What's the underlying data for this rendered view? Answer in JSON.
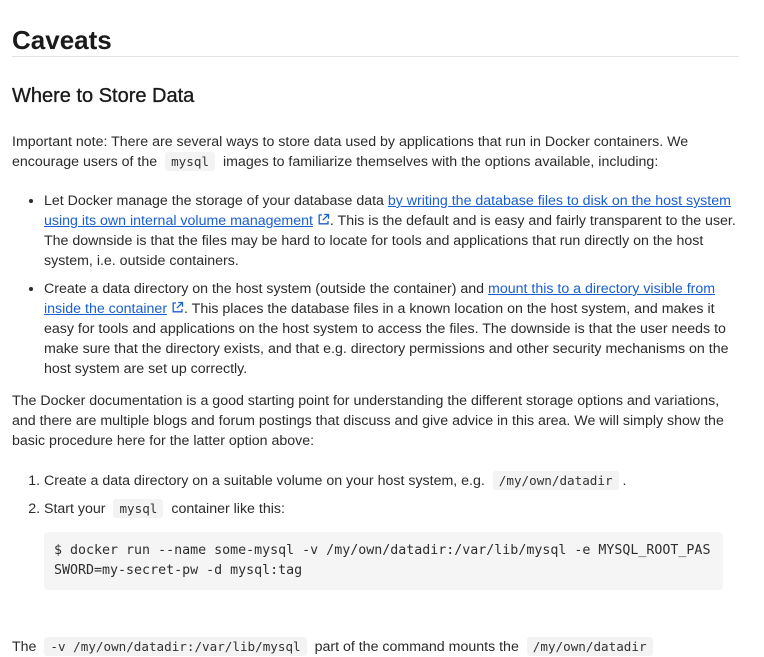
{
  "heading": "Caveats",
  "subheading": "Where to Store Data",
  "intro": {
    "before_code": "Important note: There are several ways to store data used by applications that run in Docker containers. We encourage users of the",
    "code": "mysql",
    "after_code": "images to familiarize themselves with the options available, including:"
  },
  "bullets": [
    {
      "before_link": "Let Docker manage the storage of your database data ",
      "link": "by writing the database files to disk on the host system using its own internal volume management",
      "after_link": ". This is the default and is easy and fairly transparent to the user. The downside is that the files may be hard to locate for tools and applications that run directly on the host system, i.e. outside containers."
    },
    {
      "before_link": "Create a data directory on the host system (outside the container) and ",
      "link": "mount this to a directory visible from inside the container",
      "after_link": ". This places the database files in a known location on the host system, and makes it easy for tools and applications on the host system to access the files. The downside is that the user needs to make sure that the directory exists, and that e.g. directory permissions and other security mechanisms on the host system are set up correctly."
    }
  ],
  "paragraph2": "The Docker documentation is a good starting point for understanding the different storage options and variations, and there are multiple blogs and forum postings that discuss and give advice in this area. We will simply show the basic procedure here for the latter option above:",
  "steps": [
    {
      "before_code": "Create a data directory on a suitable volume on your host system, e.g.",
      "code": "/my/own/datadir",
      "after_code": "."
    },
    {
      "before_code": "Start your",
      "code": "mysql",
      "after_code": "container like this:"
    }
  ],
  "command": "$ docker run --name some-mysql -v /my/own/datadir:/var/lib/mysql -e MYSQL_ROOT_PASSWORD=my-secret-pw -d mysql:tag",
  "paragraph3": {
    "before_code": "The",
    "code": "-v /my/own/datadir:/var/lib/mysql",
    "middle": "part of the command mounts the",
    "code2": "/my/own/datadir"
  },
  "colors": {
    "link": "#1a5fd0",
    "code_bg": "#f3f3f3",
    "rule": "#e3e3e3"
  },
  "icons": {
    "external_link": "external-link-icon"
  }
}
